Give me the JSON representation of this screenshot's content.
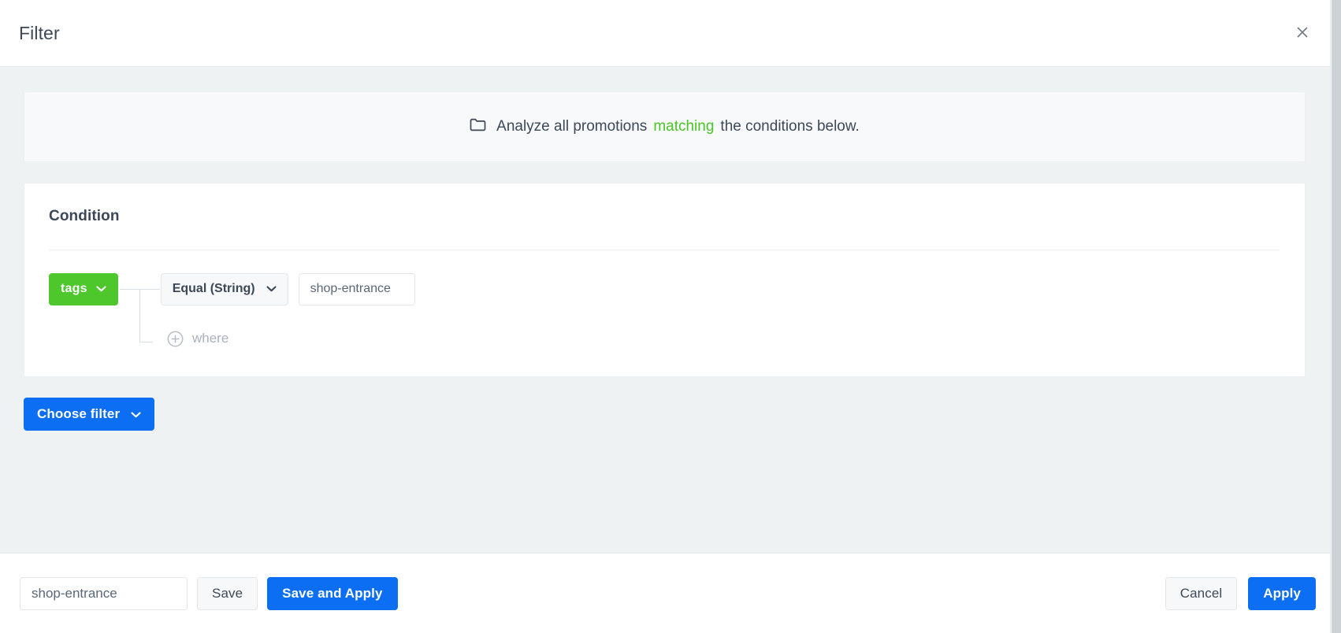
{
  "header": {
    "title": "Filter",
    "close_icon": "close-icon"
  },
  "banner": {
    "icon": "folder-icon",
    "text_before": "Analyze all promotions",
    "highlight": "matching",
    "text_after": "the conditions below.",
    "highlight_color": "#4ac426"
  },
  "condition_card": {
    "title": "Condition",
    "rule": {
      "field_label": "tags",
      "field_color": "#4ec72c",
      "field_chevron_icon": "chevron-down-icon",
      "operator_label": "Equal (String)",
      "operator_chevron_icon": "chevron-down-icon",
      "value": "shop-entrance",
      "value_placeholder": "Value"
    },
    "add_row": {
      "icon": "plus-circle-icon",
      "label": "where"
    }
  },
  "choose_filter": {
    "label": "Choose filter",
    "chevron_icon": "chevron-down-icon",
    "color": "#0c6ef2"
  },
  "footer": {
    "name_value": "shop-entrance",
    "name_placeholder": "Filter name",
    "save_label": "Save",
    "save_apply_label": "Save and Apply",
    "cancel_label": "Cancel",
    "apply_label": "Apply",
    "primary_color": "#0c6ef2"
  }
}
